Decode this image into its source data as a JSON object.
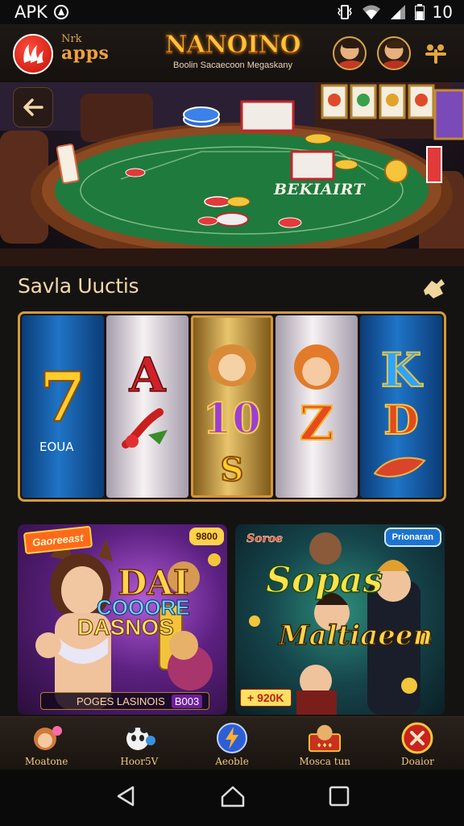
{
  "status_bar": {
    "carrier": "APK",
    "time": "10"
  },
  "header": {
    "logo_small": "Nrk",
    "logo_big": "apps",
    "brand_title": "NANOINO",
    "brand_subtitle": "Boolin Sacaecoon Megaskany"
  },
  "hero": {
    "table_text": "BEKIAIRT"
  },
  "section": {
    "title": "Savla Uuctis"
  },
  "slot": {
    "reels": [
      {
        "symbol": "7",
        "label": "EOUA"
      },
      {
        "symbol": "A",
        "label": ""
      },
      {
        "symbol": "10",
        "label": ""
      },
      {
        "symbol": "Z",
        "label": ""
      },
      {
        "symbol": "K",
        "label": ""
      }
    ],
    "reel_lower_symbols": [
      "",
      "",
      "S",
      "",
      "D"
    ]
  },
  "promo_left": {
    "badge_tl": "Gaoreeast",
    "badge_tr": "9800",
    "headline": "DAI",
    "sub1": "COOORE",
    "sub2": "DASNOS",
    "footer_text": "POGES LASINOIS",
    "footer_price": "B003"
  },
  "promo_right": {
    "badge_tl": "Soroe",
    "badge_tr": "Prionaran",
    "headline1": "Sopas",
    "headline2": "Maltiaeen",
    "footer": "+ 920K"
  },
  "bottom_nav": [
    {
      "label": "Moatone",
      "icon": "mascot-icon"
    },
    {
      "label": "Hoor5V",
      "icon": "panda-icon"
    },
    {
      "label": "Aeoble",
      "icon": "lightning-icon"
    },
    {
      "label": "Mosca tun",
      "icon": "shop-icon"
    },
    {
      "label": "Doaior",
      "icon": "close-icon"
    }
  ],
  "colors": {
    "accent_gold": "#d29a3c",
    "brand_red": "#c2120a",
    "felt_green": "#1f7a3e"
  }
}
